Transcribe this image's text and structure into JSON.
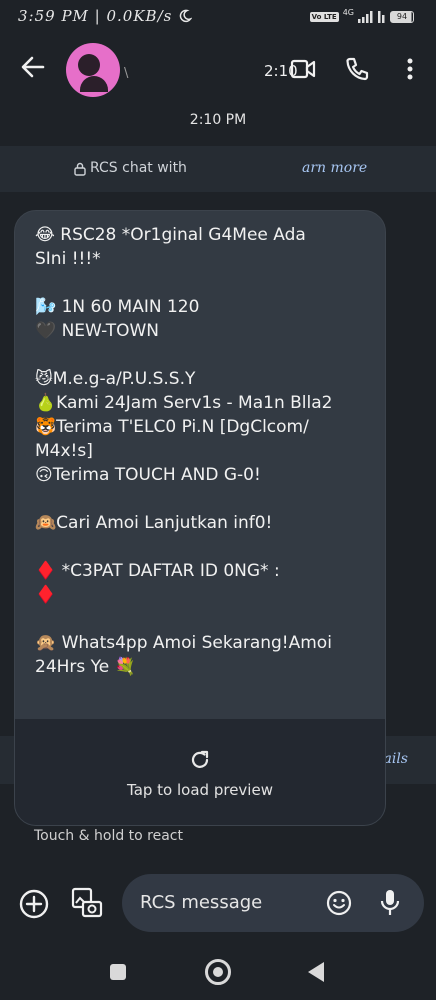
{
  "status_bar": {
    "time_speed": "3:59 PM | 0.0KB/s",
    "moon_icon": "moon-icon",
    "volte": "Vo LTE",
    "network": "4G",
    "battery": "94"
  },
  "header": {
    "contact_mark": "\\",
    "video_time_overlay": "2:10",
    "icons": [
      "back-arrow-icon",
      "video-call-icon",
      "phone-icon",
      "more-vert-icon"
    ]
  },
  "timestamp": "2:10 PM",
  "rcs_banner": {
    "text": "RCS chat with",
    "learn_more": "arn more"
  },
  "details_link": "ails",
  "message": {
    "lines": [
      "😂 RSC28 *Or1ginal G4Mee Ada",
      "SIni !!!*",
      "",
      "🌬️ 1N 60 MAIN 120",
      "🖤 NEW-TOWN",
      "",
      "😼M.e.g-a/P.U.S.S.Y",
      "🍐Kami 24Jam Serv1s - Ma1n Blla2",
      "🐯Terima T'ELC0 Pi.N [DgClcom/",
      "M4x!s]",
      "🙃Terima TOUCH AND G-0!",
      "",
      "🙉Cari Amoi Lanjutkan inf0!",
      "",
      "♦️  *C3PAT DAFTAR ID 0NG* :",
      "  ♦️",
      "",
      "🙊 Whats4pp Amoi Sekarang!Amoi",
      "24Hrs Ye 💐"
    ],
    "preview_label": "Tap to load preview"
  },
  "react_hint": "Touch & hold to react",
  "composer": {
    "placeholder": "RCS message"
  },
  "colors": {
    "background": "#1e2227",
    "bubble": "#333a43",
    "banner": "#262c33",
    "avatar": "#e66fc9",
    "link": "#a7c6f2"
  }
}
